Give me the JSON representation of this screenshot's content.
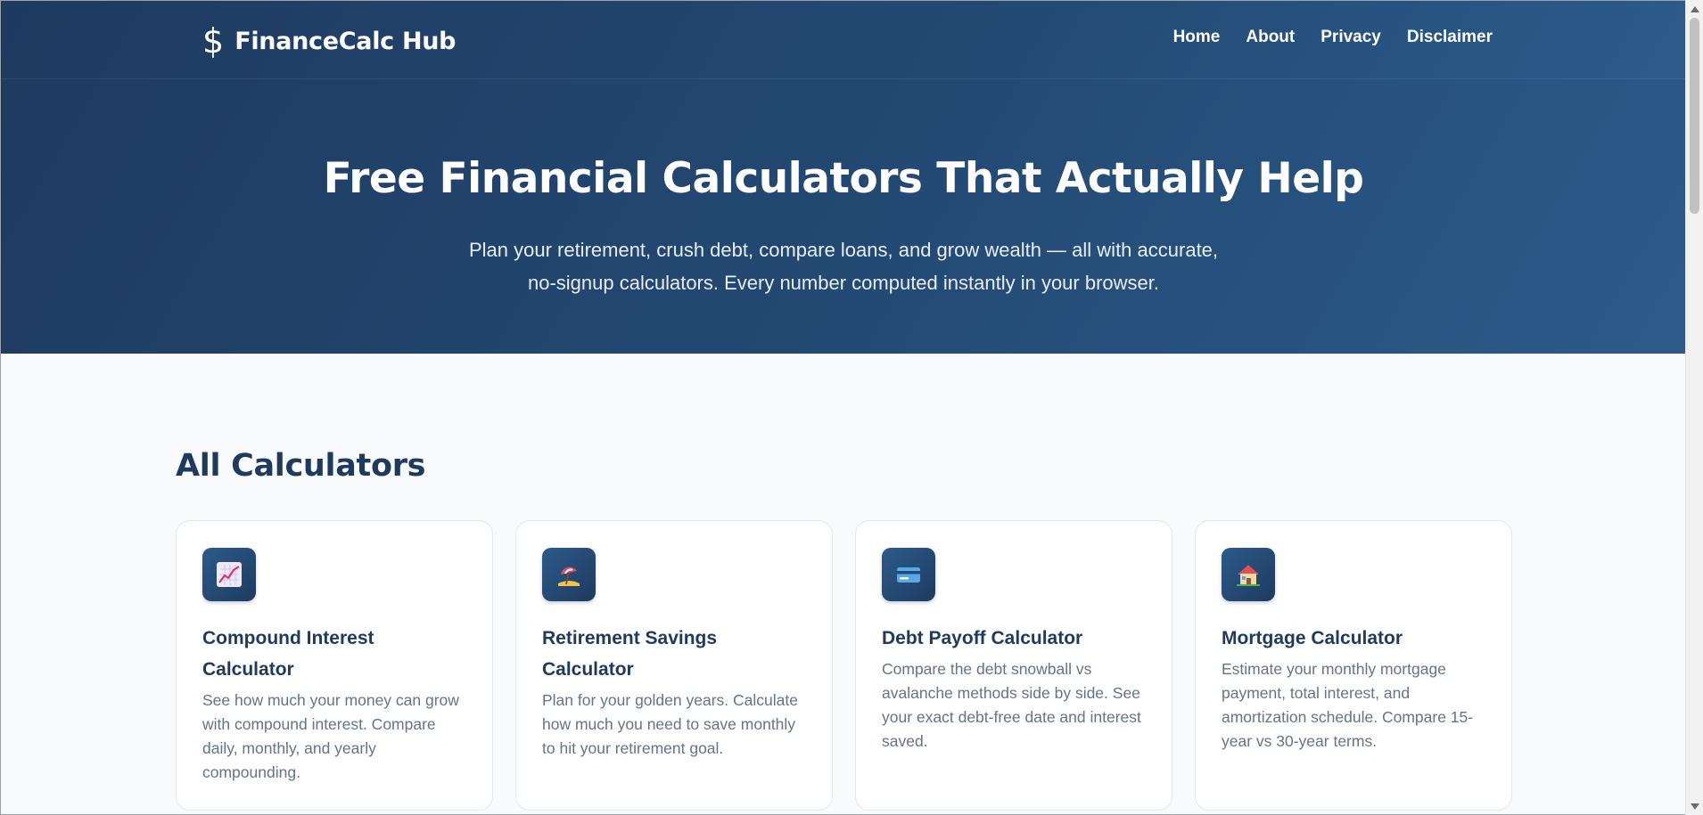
{
  "header": {
    "logo_icon": "$",
    "brand_name": "FinanceCalc Hub",
    "nav": [
      "Home",
      "About",
      "Privacy",
      "Disclaimer"
    ]
  },
  "hero": {
    "title": "Free Financial Calculators That Actually Help",
    "subtitle_line1": "Plan your retirement, crush debt, compare loans, and grow wealth — all with accurate,",
    "subtitle_line2": "no-signup calculators. Every number computed instantly in your browser."
  },
  "section": {
    "title": "All Calculators"
  },
  "cards": [
    {
      "icon": "chart-increasing-icon",
      "title": "Compound Interest Calculator",
      "description": "See how much your money can grow with compound interest. Compare daily, monthly, and yearly compounding."
    },
    {
      "icon": "beach-umbrella-icon",
      "title": "Retirement Savings Calculator",
      "description": "Plan for your golden years. Calculate how much you need to save monthly to hit your retirement goal."
    },
    {
      "icon": "credit-card-icon",
      "title": "Debt Payoff Calculator",
      "description": "Compare the debt snowball vs avalanche methods side by side. See your exact debt-free date and interest saved."
    },
    {
      "icon": "house-icon",
      "title": "Mortgage Calculator",
      "description": "Estimate your monthly mortgage payment, total interest, and amortization schedule. Compare 15-year vs 30-year terms."
    }
  ],
  "colors": {
    "primary": "#1e3a5f",
    "text_muted": "#64748b",
    "background": "#f8fafc"
  }
}
